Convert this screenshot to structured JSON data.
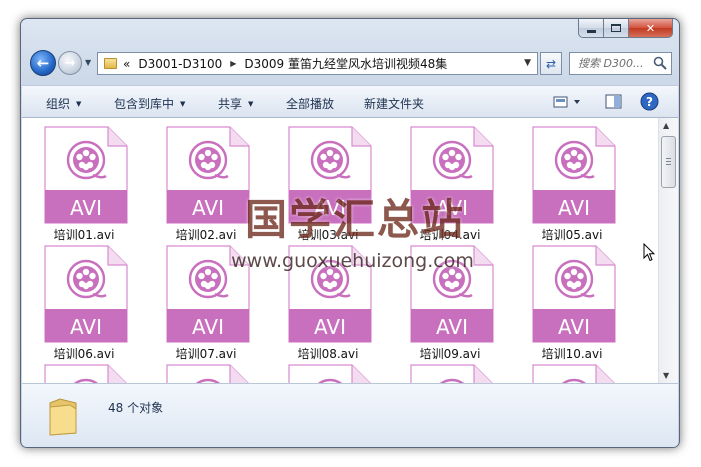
{
  "window": {
    "caption": {
      "minimize_glyph": "minimize-icon",
      "maximize_glyph": "maximize-icon",
      "close_glyph": "✕"
    }
  },
  "navigation": {
    "back_glyph": "←",
    "forward_glyph": "→",
    "breadcrumb_overflow": "«",
    "breadcrumb": [
      "D3001-D3100",
      "D3009 董笛九经堂风水培训视频48集"
    ],
    "search_placeholder": "搜索 D300..."
  },
  "toolbar": {
    "organize": "组织",
    "include_in_library": "包含到库中",
    "share": "共享",
    "play_all": "全部播放",
    "new_folder": "新建文件夹"
  },
  "files": {
    "badge": "AVI",
    "items": [
      "培训01.avi",
      "培训02.avi",
      "培训03.avi",
      "培训04.avi",
      "培训05.avi",
      "培训06.avi",
      "培训07.avi",
      "培训08.avi",
      "培训09.avi",
      "培训10.avi",
      "",
      "",
      "",
      "",
      ""
    ],
    "accent_color": "#c86fbd",
    "icon_line_color": "#d98bd0"
  },
  "status": {
    "item_count_text": "48 个对象"
  },
  "watermark": {
    "title": "国学汇总站",
    "url": "www.guoxuehuizong.com"
  }
}
